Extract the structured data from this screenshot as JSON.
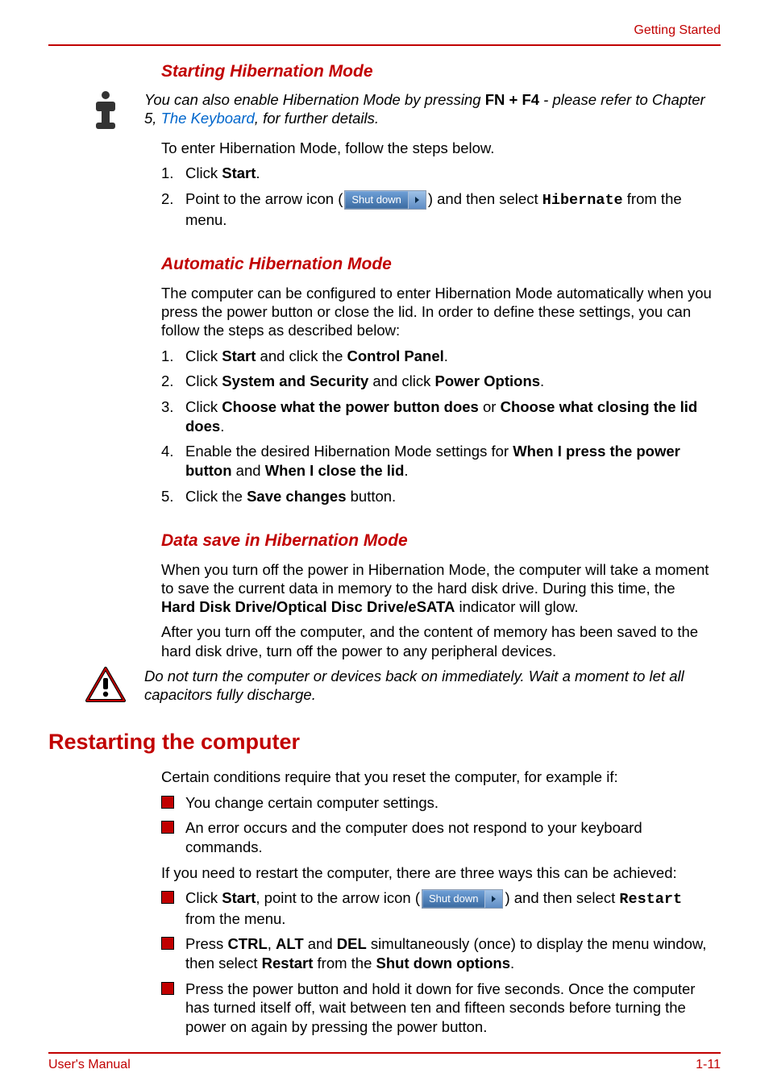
{
  "header": {
    "section": "Getting Started"
  },
  "footer": {
    "left": "User's Manual",
    "right": "1-11"
  },
  "shutdown_button_label": "Shut down",
  "headings": {
    "starting_hibernation": "Starting Hibernation Mode",
    "automatic_hibernation": "Automatic Hibernation Mode",
    "data_save": "Data save in Hibernation Mode",
    "restarting": "Restarting the computer"
  },
  "note1": {
    "prefix": "You can also enable Hibernation Mode by pressing ",
    "keys": "FN + F4",
    "mid": " - please refer to Chapter 5, ",
    "link": "The Keyboard",
    "suffix": ", for further details."
  },
  "starting": {
    "intro": "To enter Hibernation Mode, follow the steps below.",
    "step1_a": "Click ",
    "step1_b": "Start",
    "step1_c": ".",
    "step2_a": "Point to the arrow icon (",
    "step2_b": ") and then select ",
    "step2_c": "Hibernate",
    "step2_d": " from the menu."
  },
  "automatic": {
    "intro": "The computer can be configured to enter Hibernation Mode automatically when you press the power button or close the lid. In order to define these settings, you can follow the steps as described below:",
    "s1_a": "Click ",
    "s1_b": "Start",
    "s1_c": " and click the ",
    "s1_d": "Control Panel",
    "s1_e": ".",
    "s2_a": "Click ",
    "s2_b": "System and Security",
    "s2_c": " and click ",
    "s2_d": "Power Options",
    "s2_e": ".",
    "s3_a": "Click ",
    "s3_b": "Choose what the power button does",
    "s3_c": " or ",
    "s3_d": "Choose what closing the lid does",
    "s3_e": ".",
    "s4_a": "Enable the desired Hibernation Mode settings for ",
    "s4_b": "When I press the power button",
    "s4_c": " and ",
    "s4_d": "When I close the lid",
    "s4_e": ".",
    "s5_a": "Click the ",
    "s5_b": "Save changes",
    "s5_c": " button."
  },
  "datasave": {
    "p1_a": "When you turn off the power in Hibernation Mode, the computer will take a moment to save the current data in memory to the hard disk drive. During this time, the ",
    "p1_b": "Hard Disk Drive/Optical Disc Drive/eSATA",
    "p1_c": " indicator will glow.",
    "p2": "After you turn off the computer, and the content of memory has been saved to the hard disk drive, turn off the power to any peripheral devices."
  },
  "warning1": "Do not turn the computer or devices back on immediately. Wait a moment to let all capacitors fully discharge.",
  "restarting": {
    "intro": "Certain conditions require that you reset the computer, for example if:",
    "b1": "You change certain computer settings.",
    "b2": "An error occurs and the computer does not respond to your keyboard commands.",
    "p2": "If you need to restart the computer, there are three ways this can be achieved:",
    "c1_a": "Click ",
    "c1_b": "Start",
    "c1_c": ", point to the arrow icon (",
    "c1_d": ") and then select ",
    "c1_e": "Restart",
    "c1_f": " from the menu.",
    "c2_a": "Press ",
    "c2_b": "CTRL",
    "c2_c": ", ",
    "c2_d": "ALT",
    "c2_e": " and ",
    "c2_f": "DEL",
    "c2_g": " simultaneously (once) to display the menu window, then select ",
    "c2_h": "Restart",
    "c2_i": " from the ",
    "c2_j": "Shut down options",
    "c2_k": ".",
    "c3": "Press the power button and hold it down for five seconds. Once the computer has turned itself off, wait between ten and fifteen seconds before turning the power on again by pressing the power button."
  }
}
